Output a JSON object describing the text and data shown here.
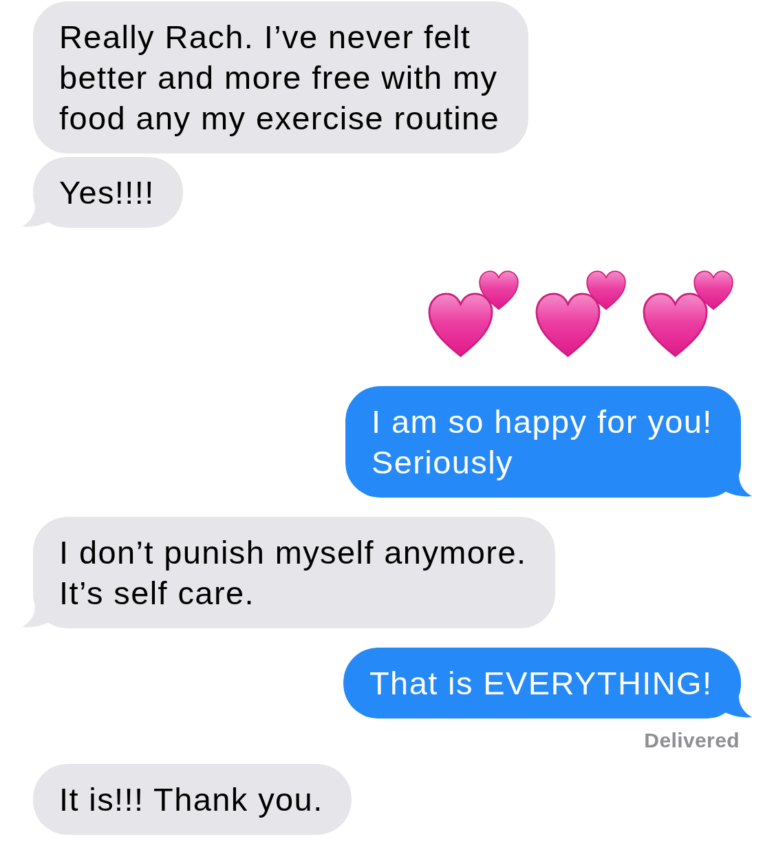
{
  "messages": [
    {
      "kind": "received",
      "text": "Really Rach. I’ve never felt better and more free with my food any my exercise routine",
      "tail": false
    },
    {
      "kind": "received",
      "text": "Yes!!!!",
      "tail": true
    },
    {
      "kind": "emoji",
      "emojis": [
        {
          "kind": "hearts"
        },
        {
          "kind": "hearts"
        },
        {
          "kind": "hearts"
        }
      ]
    },
    {
      "kind": "sent",
      "text": "I am so happy for you! Seriously",
      "tail": true
    },
    {
      "kind": "received",
      "text": "I don’t punish myself anymore. It’s self care.",
      "tail": true
    },
    {
      "kind": "sent",
      "text": "That is EVERYTHING!",
      "tail": true,
      "receipt": "Delivered"
    },
    {
      "kind": "received",
      "text": "It is!!! Thank you.",
      "tail": false
    }
  ]
}
